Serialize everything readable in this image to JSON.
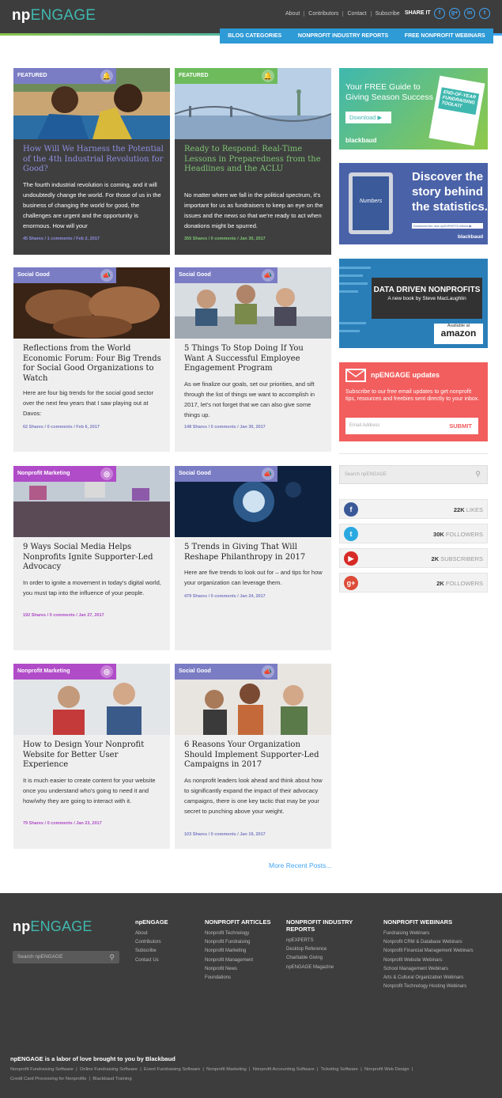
{
  "header": {
    "logo_np": "np",
    "logo_engage": "ENGAGE",
    "links": [
      "About",
      "Contributors",
      "Contact",
      "Subscribe"
    ],
    "share_label": "SHARE IT",
    "nav": [
      "BLOG CATEGORIES",
      "NONPROFIT INDUSTRY REPORTS",
      "FREE NONPROFIT WEBINARS"
    ]
  },
  "cards": [
    {
      "badge": "FEATURED",
      "title": "How Will We Harness the Potential of the 4th Industrial Revolution for Good?",
      "excerpt": "The fourth industrial revolution is coming, and it will undoubtedly change the world. For those of us in the business of changing the world for good, the challenges are urgent and the opportunity is enormous. How will your",
      "meta": "45 Shares / 1 comments / Feb 2, 2017"
    },
    {
      "badge": "FEATURED",
      "title": "Ready to Respond: Real-Time Lessons in Preparedness from the Headlines and the ACLU",
      "excerpt": "No matter where we fall in the political spectrum, it's important for us as fundraisers to keep an eye on the issues and the news so that we're ready to act when donations might be spurred.",
      "meta": "355 Shares / 0 comments / Jan 30, 2017"
    },
    {
      "badge": "Social Good",
      "title": "Reflections from the World Economic Forum: Four Big Trends for Social Good Organizations to Watch",
      "excerpt": "Here are four big trends for the social good sector over the next few years that I saw playing out at Davos:",
      "meta": "62 Shares / 0 comments / Feb 6, 2017"
    },
    {
      "badge": "Social Good",
      "title": "5 Things To Stop Doing If You Want A Successful Employee Engagement Program",
      "excerpt": "As we finalize our goals, set our priorities, and sift through the list of things we want to accomplish in 2017, let's not forget that we can also give some things up.",
      "meta": "148 Shares / 0 comments / Jan 30, 2017"
    },
    {
      "badge": "Nonprofit Marketing",
      "title": "9 Ways Social Media Helps Nonprofits Ignite Supporter-Led Advocacy",
      "excerpt": "In order to ignite a movement in today's digital world, you must tap into the influence of your people.",
      "meta": "192 Shares / 0 comments / Jan 27, 2017"
    },
    {
      "badge": "Social Good",
      "title": "5 Trends in Giving That Will Reshape Philanthropy in 2017",
      "excerpt": "Here are five trends to look out for – and tips for how your organization can leverage them.",
      "meta": "479 Shares / 0 comments / Jan 24, 2017"
    },
    {
      "badge": "Nonprofit Marketing",
      "title": "How to Design Your Nonprofit Website for Better User Experience",
      "excerpt": "It is much easier to create content for your website once you understand who's going to need it and how/why they are going to interact with it.",
      "meta": "79 Shares / 0 comments / Jan 23, 2017"
    },
    {
      "badge": "Social Good",
      "title": "6 Reasons Your Organization Should Implement Supporter-Led Campaigns in 2017",
      "excerpt": "As nonprofit leaders look ahead and think about how to significantly expand the impact of their advocacy campaigns, there is one key tactic that may be your secret to punching above your weight.",
      "meta": "103 Shares / 0 comments / Jan 19, 2017"
    }
  ],
  "more_posts": "More Recent Posts...",
  "ads": {
    "ad1_line1": "Your FREE Guide to",
    "ad1_line2": "Giving Season Success",
    "ad1_btn": "Download",
    "ad1_book": "END-OF-YEAR FUNDRAISING TOOLKIT",
    "ad1_brand": "blackbaud",
    "ad2_line1": "Discover the",
    "ad2_line2": "story behind",
    "ad2_line3": "the statistics.",
    "ad2_tablet": "Numbers",
    "ad2_note": "Download the new npEXPERTS eBook ▶",
    "ad2_brand": "blackbaud",
    "ad3_title": "DATA DRIVEN NONPROFITS",
    "ad3_sub": "A new book by Steve MacLaughlin",
    "ad3_avail": "Available at",
    "ad3_store": "amazon"
  },
  "updates": {
    "title": "npENGAGE updates",
    "text": "Subscribe to our free email updates to get nonprofit tips, resources and freebies sent directly to your inbox.",
    "placeholder": "Email Address",
    "button": "SUBMIT"
  },
  "sidebar_search": "Search npENGAGE",
  "social": [
    {
      "icon": "f",
      "count": "22K",
      "label": "LIKES",
      "color": "#3b5998"
    },
    {
      "icon": "t",
      "count": "30K",
      "label": "FOLLOWERS",
      "color": "#2aa9e0"
    },
    {
      "icon": "▶",
      "count": "2K",
      "label": "SUBSCRIBERS",
      "color": "#d62a27"
    },
    {
      "icon": "g+",
      "count": "2K",
      "label": "FOLLOWERS",
      "color": "#dd4b39"
    }
  ],
  "footer": {
    "search": "Search npENGAGE",
    "col1": {
      "title": "npENGAGE",
      "items": [
        "About",
        "Contributors",
        "Subscribe",
        "Contact Us"
      ]
    },
    "col2": {
      "title": "NONPROFIT ARTICLES",
      "items": [
        "Nonprofit Technology",
        "Nonprofit Fundraising",
        "Nonprofit Marketing",
        "Nonprofit Management",
        "Nonprofit News",
        "Foundations"
      ]
    },
    "col3": {
      "title": "NONPROFIT INDUSTRY REPORTS",
      "items": [
        "npEXPERTS",
        "Desktop Reference",
        "Charitable Giving",
        "npENGAGE Magazine"
      ]
    },
    "col4": {
      "title": "NONPROFIT WEBINARS",
      "items": [
        "Fundraising Webinars",
        "Nonprofit CRM & Database Webinars",
        "Nonprofit Financial Management Webinars",
        "Nonprofit Website Webinars",
        "School Management Webinars",
        "Arts & Cultural Organization Webinars",
        "Nonprofit Technology Hosting Webinars"
      ]
    },
    "bottom_title": "npENGAGE is a labor of love brought to you by Blackbaud",
    "bottom_links": [
      "Nonprofit Fundraising Software",
      "Online Fundraising Software",
      "Event Fundraising Software",
      "Nonprofit Marketing",
      "Nonprofit Accounting Software",
      "Ticketing Software",
      "Nonprofit Web Design",
      "Credit Card Processing for Nonprofits",
      "Blackbaud Training"
    ]
  }
}
